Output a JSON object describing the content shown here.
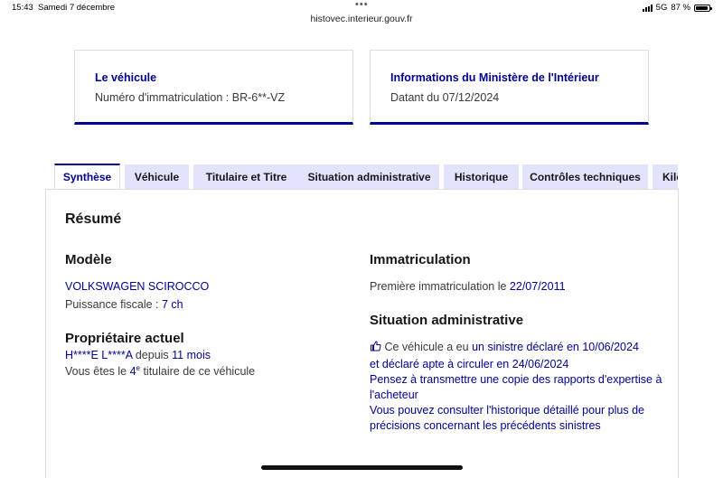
{
  "status_bar": {
    "time": "15:43",
    "date": "Samedi 7 décembre",
    "network": "5G",
    "battery": "87 %"
  },
  "browser": {
    "url": "histovec.interieur.gouv.fr"
  },
  "cards": [
    {
      "title": "Le véhicule",
      "text": "Numéro d'immatriculation : BR-6**-VZ"
    },
    {
      "title": "Informations du Ministère de l'Intérieur",
      "text": "Datant du 07/12/2024"
    }
  ],
  "tabs": [
    "Synthèse",
    "Véhicule",
    "Titulaire et Titre",
    "Situation administrative",
    "Historique",
    "Contrôles techniques",
    "Kilo"
  ],
  "resume": {
    "title": "Résumé",
    "modele": {
      "title": "Modèle",
      "name": "VOLKSWAGEN SCIROCCO",
      "puissance_label": "Puissance fiscale : ",
      "puissance_value": "7 ch"
    },
    "proprietaire": {
      "title": "Propriétaire actuel",
      "name": "H****E L****A",
      "depuis_label": " depuis ",
      "depuis_value": "11 mois",
      "rank_prefix": "Vous êtes le ",
      "rank_num": "4",
      "rank_sup": "e",
      "rank_suffix": " titulaire de ce véhicule"
    },
    "immatriculation": {
      "title": "Immatriculation",
      "label": "Première immatriculation le ",
      "date": "22/07/2011"
    },
    "situation": {
      "title": "Situation administrative",
      "line1_prefix": " Ce véhicule a eu ",
      "line1_link": "un sinistre déclaré en 10/06/2024",
      "line2_prefix": "et ",
      "line2_link": "déclaré apte à circuler en 24/06/2024",
      "advice1a": "Pensez à transmettre une copie des rapports d'expertise à",
      "advice1b": "l'acheteur",
      "advice2a": "Vous pouvez consulter l'historique détaillé pour plus de",
      "advice2b": "précisions concernant les précédents sinistres"
    }
  }
}
